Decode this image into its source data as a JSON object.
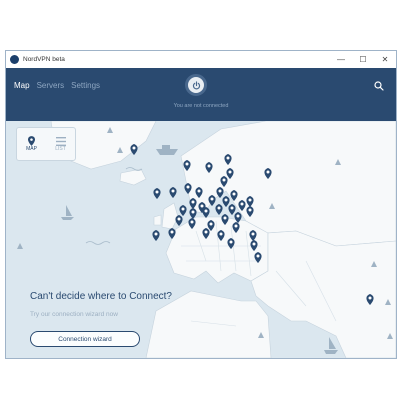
{
  "app": {
    "title": "NordVPN beta"
  },
  "window_controls": {
    "minimize": "—",
    "maximize": "☐",
    "close": "✕"
  },
  "nav": {
    "tabs": [
      {
        "label": "Map"
      },
      {
        "label": "Servers"
      },
      {
        "label": "Settings"
      }
    ],
    "active": "Map"
  },
  "status": {
    "text": "You are not connected"
  },
  "view_toggle": {
    "map_label": "MAP",
    "list_label": "LIST",
    "active": "MAP"
  },
  "promo": {
    "title": "Can't decide where to Connect?",
    "subtitle": "Try our connection wizard now",
    "button_label": "Connection wizard"
  },
  "icons": {
    "search": "search-icon",
    "power": "power-icon",
    "pin": "location-pin-icon"
  },
  "colors": {
    "header_bg": "#2a4a70",
    "pin": "#2a4a70",
    "map_bg": "#dbe7ef",
    "land": "#f7f9fa"
  }
}
